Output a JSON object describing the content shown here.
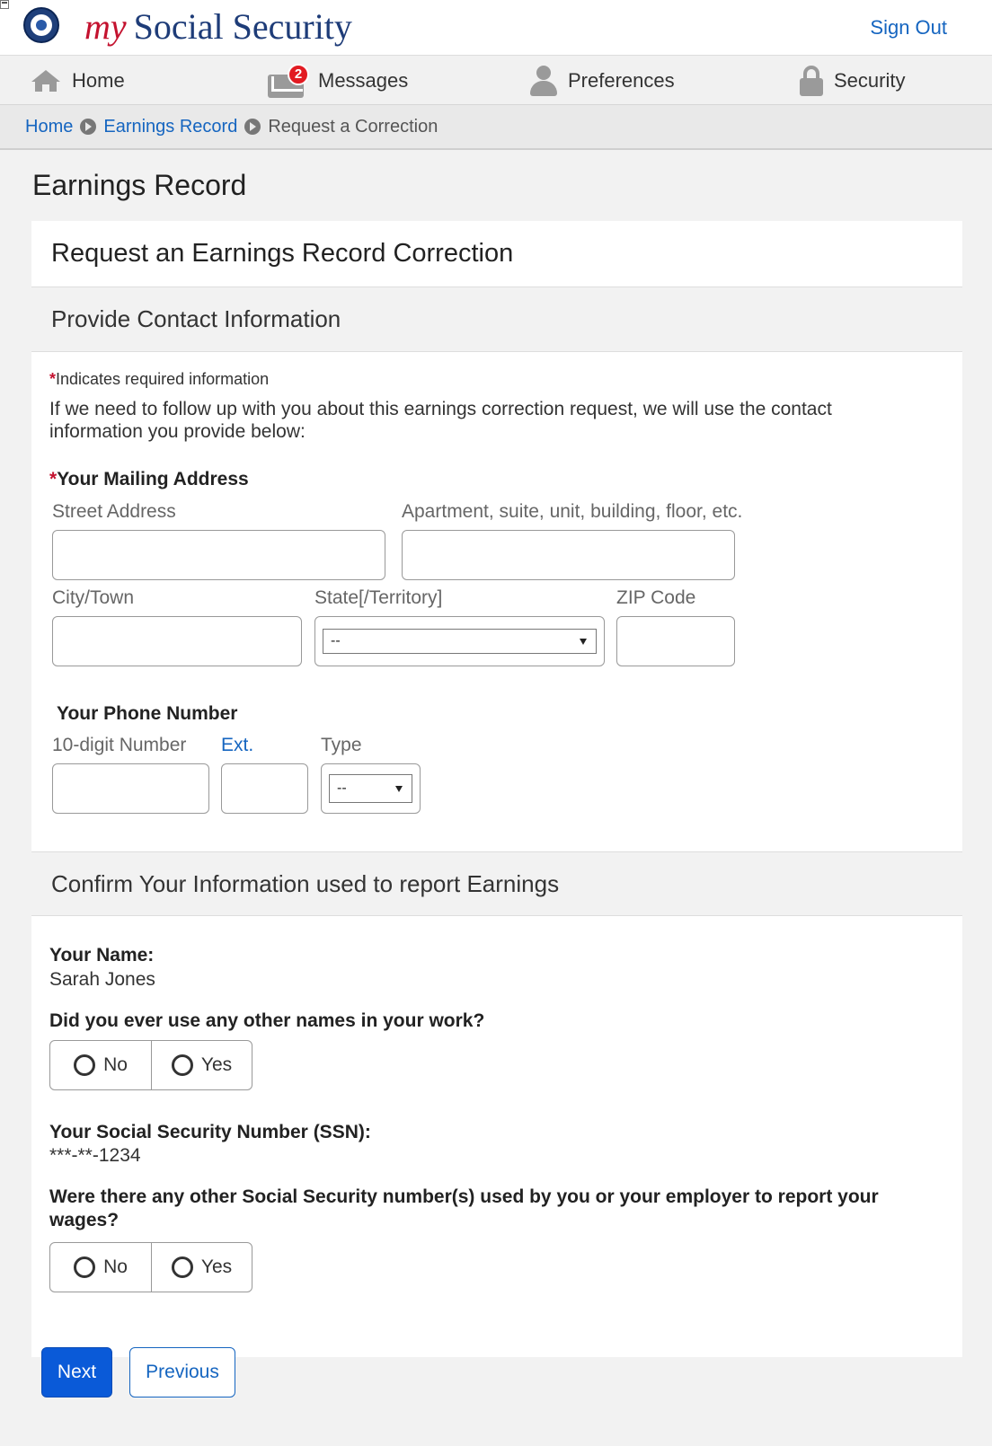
{
  "header": {
    "brand_my": "my",
    "brand_rest": "Social Security",
    "sign_out": "Sign Out"
  },
  "nav": {
    "items": [
      {
        "label": "Home",
        "icon": "home-icon"
      },
      {
        "label": "Messages",
        "icon": "envelope-icon",
        "badge": "2"
      },
      {
        "label": "Preferences",
        "icon": "user-icon"
      },
      {
        "label": "Security",
        "icon": "lock-icon"
      }
    ]
  },
  "breadcrumb": {
    "items": [
      "Home",
      "Earnings Record",
      "Request a Correction"
    ]
  },
  "page": {
    "title": "Earnings Record",
    "card_title": "Request an Earnings Record Correction"
  },
  "contact": {
    "heading": "Provide Contact Information",
    "required_star": "*",
    "required_note": "Indicates required information",
    "intro": "If we need to follow up with you about this earnings correction request, we will use the contact information you provide below:",
    "mailing_label": "Your Mailing Address",
    "street_label": "Street Address",
    "street_value": "",
    "apt_label": "Apartment, suite, unit, building, floor, etc.",
    "apt_value": "",
    "city_label": "City/Town",
    "city_value": "",
    "state_label": "State[/Territory]",
    "state_value": "--",
    "zip_label": "ZIP Code",
    "zip_value": "",
    "phone_label": "Your Phone Number",
    "phone_number_label": "10-digit Number",
    "phone_ext_label": "Ext.",
    "phone_type_label": "Type",
    "phone_type_value": "--"
  },
  "confirm": {
    "heading": "Confirm Your Information used to report Earnings",
    "name_label": "Your Name:",
    "name_value": "Sarah Jones",
    "other_names_question": "Did you ever use any other names in your work?",
    "ssn_label": "Your Social Security Number (SSN):",
    "ssn_value": "***-**-1234",
    "other_ssn_question": "Were there any other Social Security number(s) used by you or your employer to report your wages?",
    "no": "No",
    "yes": "Yes"
  },
  "buttons": {
    "next": "Next",
    "previous": "Previous"
  },
  "colors": {
    "link": "#1565c0",
    "primary_button": "#0a5ad8",
    "required": "#c4122f",
    "badge": "#e21b22"
  }
}
